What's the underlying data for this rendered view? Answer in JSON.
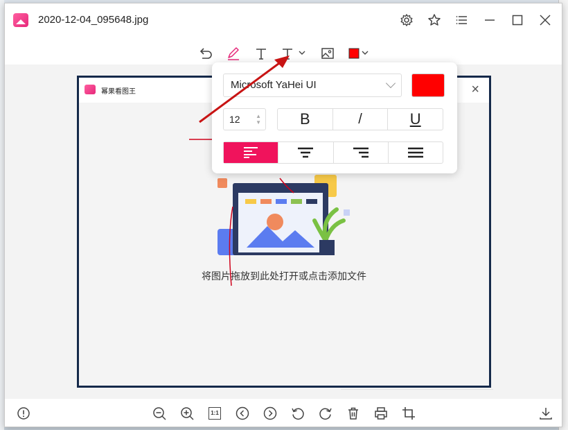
{
  "window": {
    "title": "2020-12-04_095648.jpg"
  },
  "title_bar_icons": [
    "app-logo-icon",
    "settings-icon",
    "favorite-star-icon",
    "menu-icon",
    "minimize-icon",
    "maximize-icon",
    "close-icon"
  ],
  "edit_toolbar": {
    "tools": [
      "undo-icon",
      "pen-icon",
      "text-icon",
      "text-style-icon",
      "image-icon",
      "color-icon"
    ],
    "current_color": "#ff0000"
  },
  "text_popup": {
    "font_family": "Microsoft YaHei UI",
    "font_size": "12",
    "color": "#ff0000",
    "bold_label": "B",
    "italic_label": "/",
    "underline_label": "U",
    "alignments": [
      "align-left-icon",
      "align-center-icon",
      "align-right-icon",
      "justify-icon"
    ],
    "active_alignment": "align-left-icon",
    "accent_color": "#f0135c"
  },
  "embedded_screenshot": {
    "app_title": "幂果看图王",
    "drop_hint": "将图片拖放到此处打开或点击添加文件",
    "annotation_color": "#d0021b",
    "frame_color": "#15294a"
  },
  "bottom_toolbar": {
    "actual_size_label": "1:1",
    "icons": [
      "info-icon",
      "zoom-out-icon",
      "zoom-in-icon",
      "actual-size-icon",
      "previous-icon",
      "next-icon",
      "rotate-left-icon",
      "rotate-right-icon",
      "delete-icon",
      "print-icon",
      "crop-icon",
      "download-icon"
    ]
  }
}
